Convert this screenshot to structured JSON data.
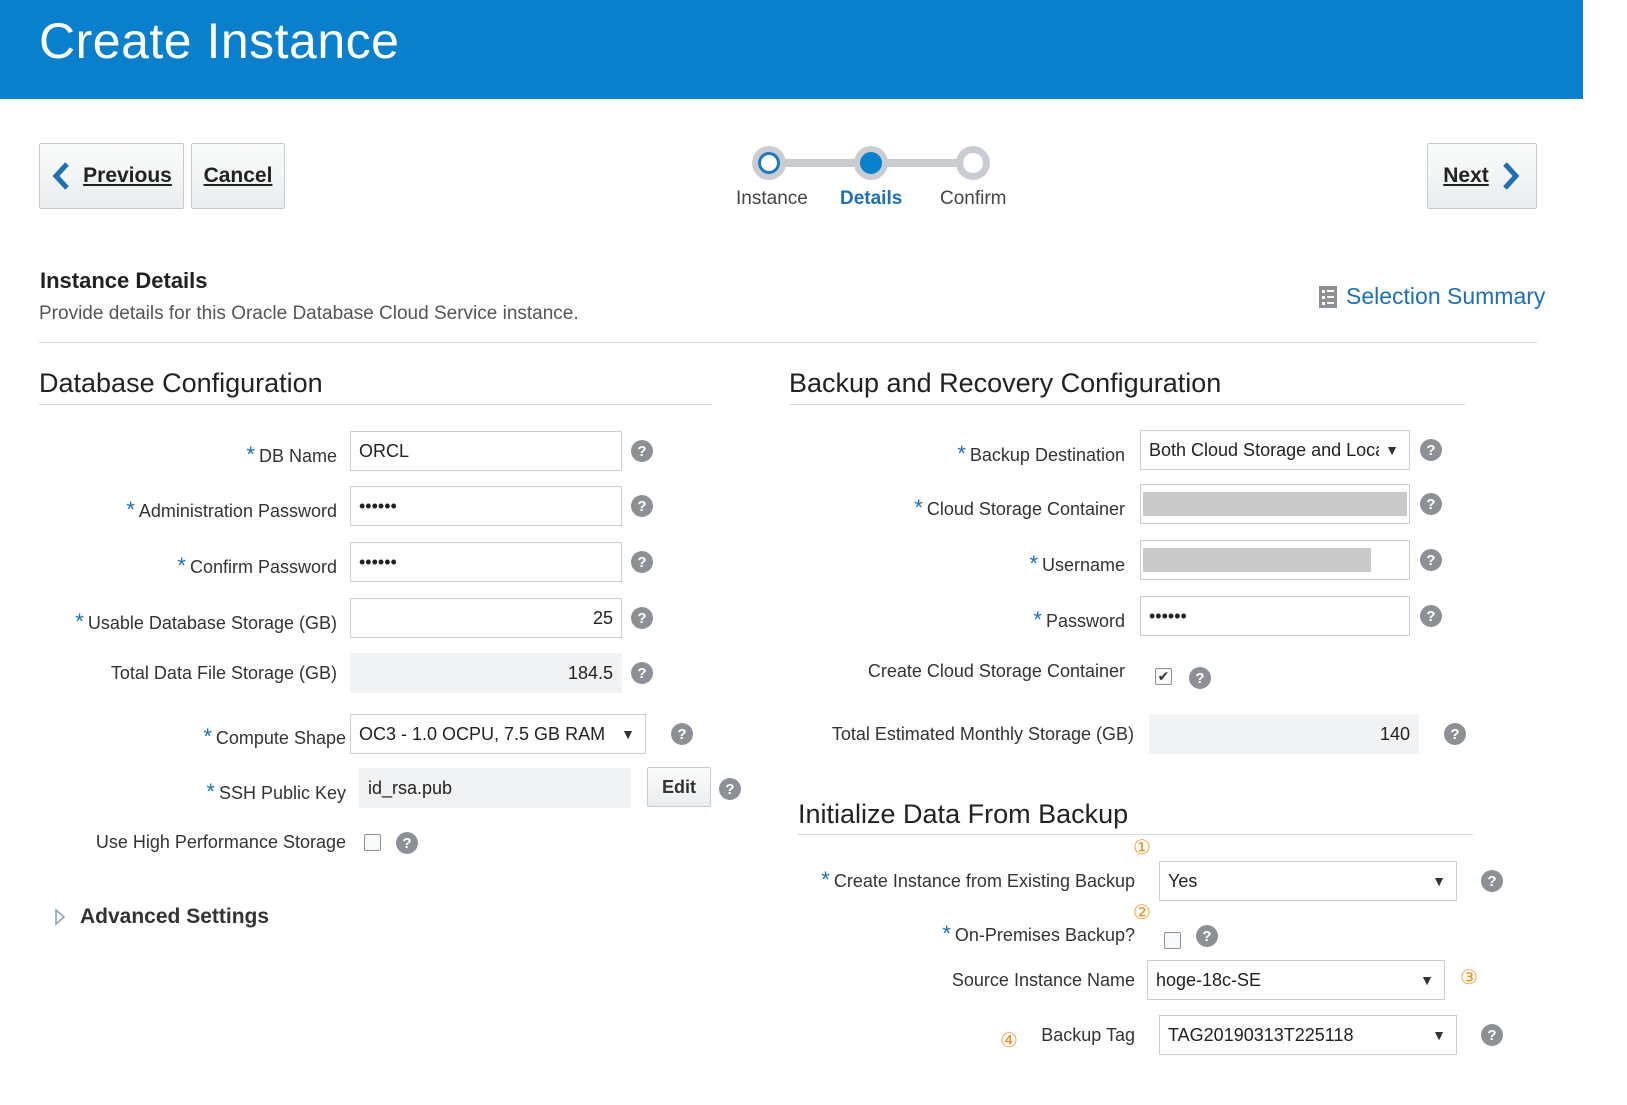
{
  "header": {
    "title": "Create Instance"
  },
  "nav": {
    "previous_label": "Previous",
    "cancel_label": "Cancel",
    "next_label": "Next"
  },
  "train": {
    "steps": [
      "Instance",
      "Details",
      "Confirm"
    ],
    "current": "Details"
  },
  "instance_details": {
    "title": "Instance Details",
    "description": "Provide details for this Oracle Database Cloud Service instance.",
    "summary_link": "Selection Summary"
  },
  "db_config": {
    "title": "Database Configuration",
    "db_name": {
      "label": "DB Name",
      "value": "ORCL"
    },
    "admin_password": {
      "label": "Administration Password",
      "value": "••••••"
    },
    "confirm_password": {
      "label": "Confirm Password",
      "value": "••••••"
    },
    "usable_storage": {
      "label": "Usable Database Storage (GB)",
      "value": "25"
    },
    "total_storage": {
      "label": "Total Data File Storage (GB)",
      "value": "184.5"
    },
    "compute_shape": {
      "label": "Compute Shape",
      "value": "OC3 - 1.0 OCPU, 7.5 GB RAM"
    },
    "ssh_key": {
      "label": "SSH Public Key",
      "value": "id_rsa.pub",
      "edit_label": "Edit"
    },
    "high_perf": {
      "label": "Use High Performance Storage"
    },
    "advanced_label": "Advanced Settings"
  },
  "backup_config": {
    "title": "Backup and Recovery Configuration",
    "destination": {
      "label": "Backup Destination",
      "value": "Both Cloud Storage and Loca"
    },
    "container": {
      "label": "Cloud Storage Container"
    },
    "username": {
      "label": "Username"
    },
    "password": {
      "label": "Password",
      "value": "••••••"
    },
    "create_container": {
      "label": "Create Cloud Storage Container",
      "check": "✔"
    },
    "monthly_storage": {
      "label": "Total Estimated Monthly Storage (GB)",
      "value": "140"
    }
  },
  "init_backup": {
    "title": "Initialize Data From Backup",
    "from_existing": {
      "label": "Create Instance from Existing Backup",
      "value": "Yes"
    },
    "on_premises": {
      "label": "On-Premises Backup?"
    },
    "source_name": {
      "label": "Source Instance Name",
      "value": "hoge-18c-SE"
    },
    "backup_tag": {
      "label": "Backup Tag",
      "value": "TAG20190313T225118"
    },
    "annotations": [
      "①",
      "②",
      "③",
      "④"
    ]
  },
  "help_glyph": "?",
  "caret_glyph": "▼",
  "required_mark": "*",
  "colors": {
    "header": "#0a7fcb",
    "link": "#1f6fb2",
    "annotation": "#e8962e"
  }
}
